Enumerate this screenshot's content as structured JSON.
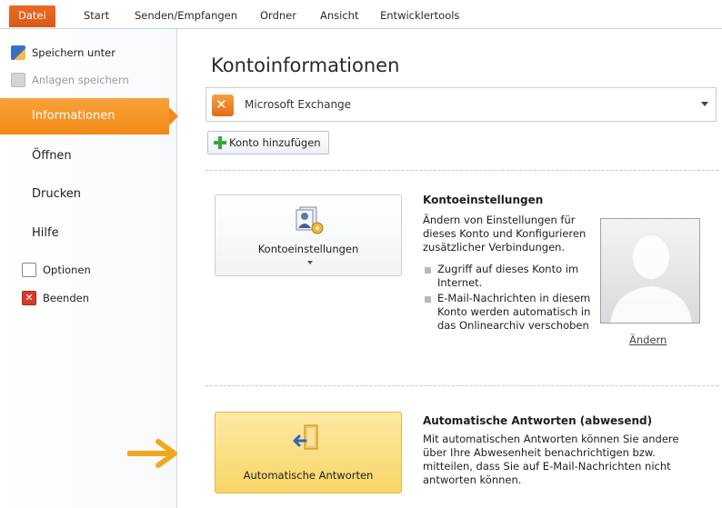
{
  "tabs": [
    "Datei",
    "Start",
    "Senden/Empfangen",
    "Ordner",
    "Ansicht",
    "Entwicklertools"
  ],
  "left_commands": [
    {
      "label": "Speichern unter",
      "icon": "save-as-icon",
      "disabled": false
    },
    {
      "label": "Anlagen speichern",
      "icon": "save-attachments-icon",
      "disabled": true
    }
  ],
  "left_menu": [
    {
      "label": "Informationen",
      "active": true
    },
    {
      "label": "Öffnen",
      "active": false
    },
    {
      "label": "Drucken",
      "active": false
    },
    {
      "label": "Hilfe",
      "active": false
    }
  ],
  "left_bottom": [
    {
      "label": "Optionen",
      "icon": "options-icon"
    },
    {
      "label": "Beenden",
      "icon": "exit-icon"
    }
  ],
  "main": {
    "title": "Kontoinformationen",
    "account": "Microsoft Exchange",
    "add_account": "Konto hinzufügen",
    "account_settings": {
      "button_label": "Kontoeinstellungen",
      "heading": "Kontoeinstellungen",
      "description": "Ändern von Einstellungen für dieses Konto und Konfigurieren zusätzlicher Verbindungen.",
      "bullets": [
        "Zugriff auf dieses Konto im Internet.",
        "E-Mail-Nachrichten in diesem Konto werden automatisch in das Onlinearchiv verschoben"
      ],
      "change_link": "Ändern"
    },
    "auto_replies": {
      "button_label": "Automatische Antworten",
      "heading": "Automatische Antworten (abwesend)",
      "description": "Mit automatischen Antworten können Sie andere über Ihre Abwesenheit benachrichtigen bzw. mitteilen, dass Sie auf E-Mail-Nachrichten nicht antworten können."
    }
  },
  "colors": {
    "accent_orange": "#f28a16",
    "file_tab": "#e0601c",
    "highlight_yellow": "#f8d567"
  }
}
